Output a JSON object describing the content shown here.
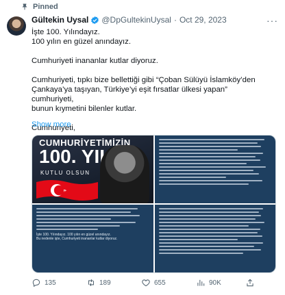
{
  "pinned_label": "Pinned",
  "author": {
    "display_name": "Gültekin Uysal",
    "handle": "@DpGultekinUysal",
    "separator": "·",
    "date": "Oct 29, 2023"
  },
  "body_lines": [
    "İşte 100. Yılındayız.",
    "100 yılın en güzel anındayız.",
    "",
    "Cumhuriyeti inananlar kutlar diyoruz.",
    "",
    "Cumhuriyeti, tıpkı bize bellettiği gibi “Çoban Sülüyü İslamköy’den",
    "Çankaya’ya taşıyan, Türkiye’yi eşit fırsatlar ülkesi yapan” cumhuriyeti,",
    "bunun kıymetini bilenler kutlar.",
    "",
    "Cumhuriyeti,"
  ],
  "show_more": "Show more",
  "media": {
    "banner_title": "CUMHURİYETİMİZİN",
    "banner_big": "100. YILI",
    "banner_sub": "KUTLU OLSUN",
    "caption_lines": [
      "İşte 100. Yılındayız. 100 yılın en güzel anındayız.",
      "Bu nedenle işte, Cumhuriyeti inananlar kutlar diyoruz."
    ]
  },
  "actions": {
    "replies": "135",
    "retweets": "189",
    "likes": "655",
    "views": "90K"
  },
  "colors": {
    "accent": "#1d9bf0",
    "muted": "#536471",
    "text_panel": "#1e3f60",
    "flag_red": "#e30a17"
  }
}
